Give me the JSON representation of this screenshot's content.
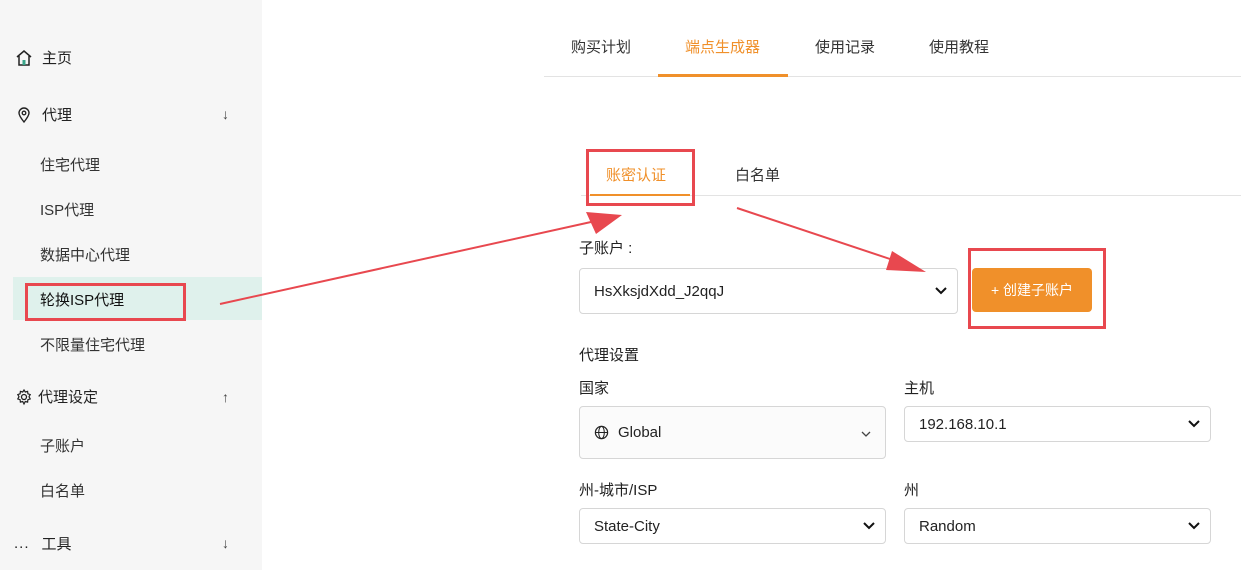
{
  "sidebar": {
    "home": "主页",
    "proxy": "代理",
    "proxy_items": [
      "住宅代理",
      "ISP代理",
      "数据中心代理",
      "轮换ISP代理",
      "不限量住宅代理"
    ],
    "proxy_settings": "代理设定",
    "settings_items": [
      "子账户",
      "白名单"
    ],
    "tools": "工具",
    "tools_prefix": "..."
  },
  "tabs": [
    "购买计划",
    "端点生成器",
    "使用记录",
    "使用教程"
  ],
  "subtabs": [
    "账密认证",
    "白名单"
  ],
  "form": {
    "subaccount_label": "子账户 :",
    "subaccount_value": "HsXksjdXdd_J2qqJ",
    "create_button": "+ 创建子账户",
    "proxy_settings_title": "代理设置",
    "country_label": "国家",
    "country_value": "Global",
    "host_label": "主机",
    "host_value": "192.168.10.1",
    "state_city_label": "州-城市/ISP",
    "state_city_value": "State-City",
    "state_label": "州",
    "state_value": "Random"
  },
  "colors": {
    "accent": "#f0902a",
    "highlight": "#e8484f",
    "active_bg": "#dff1ec"
  }
}
